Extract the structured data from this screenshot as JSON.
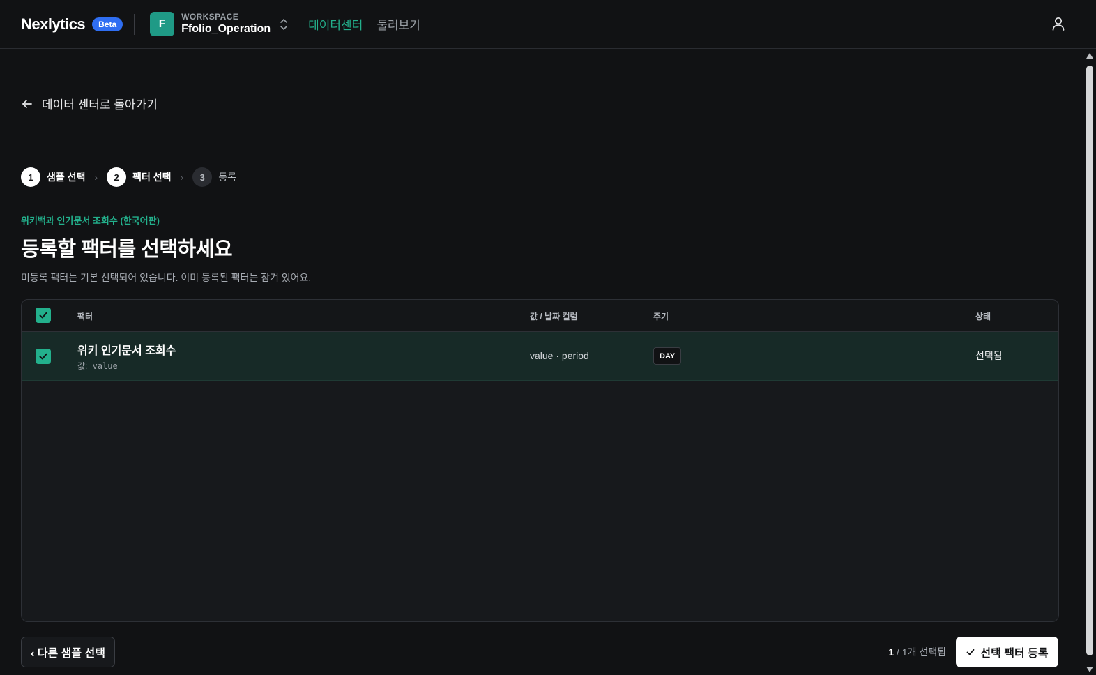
{
  "header": {
    "logo": "Nexlytics",
    "badge": "Beta",
    "workspace": {
      "initial": "F",
      "caption": "WORKSPACE",
      "name": "Ffolio_Operation"
    },
    "nav": [
      {
        "label": "데이터센터",
        "active": true
      },
      {
        "label": "둘러보기",
        "active": false
      }
    ]
  },
  "back_link": {
    "label": "데이터 센터로 돌아가기"
  },
  "stepper": [
    {
      "number": "1",
      "label": "샘플 선택",
      "state": "done"
    },
    {
      "number": "2",
      "label": "팩터 선택",
      "state": "current"
    },
    {
      "number": "3",
      "label": "등록",
      "state": "todo"
    }
  ],
  "page": {
    "eyebrow": "위키백과 인기문서 조회수 (한국어판)",
    "title": "등록할 팩터를 선택하세요",
    "description": "미등록 팩터는 기본 선택되어 있습니다. 이미 등록된 팩터는 잠겨 있어요."
  },
  "table": {
    "columns": [
      "팩터",
      "값 / 날짜 컬럼",
      "주기",
      "상태"
    ],
    "header_checkbox_checked": true,
    "rows": [
      {
        "checked": true,
        "name": "위키 인기문서 조회수",
        "value_prefix": "값:",
        "value_col": "value",
        "columns": "value · period",
        "period": "DAY",
        "status": "선택됨"
      }
    ]
  },
  "footer": {
    "prev_label": "‹ 다른 샘플 선택",
    "selected": "1",
    "selected_suffix": " / 1개 선택됨",
    "submit_label": "선택 팩터 등록"
  },
  "colors": {
    "accent": "#23b08c",
    "beta": "#2f6ef2",
    "background": "#111214",
    "row_selected": "#172a27"
  },
  "icons": [
    "arrow-left-icon",
    "chevron-updown-icon",
    "user-icon",
    "check-icon"
  ]
}
